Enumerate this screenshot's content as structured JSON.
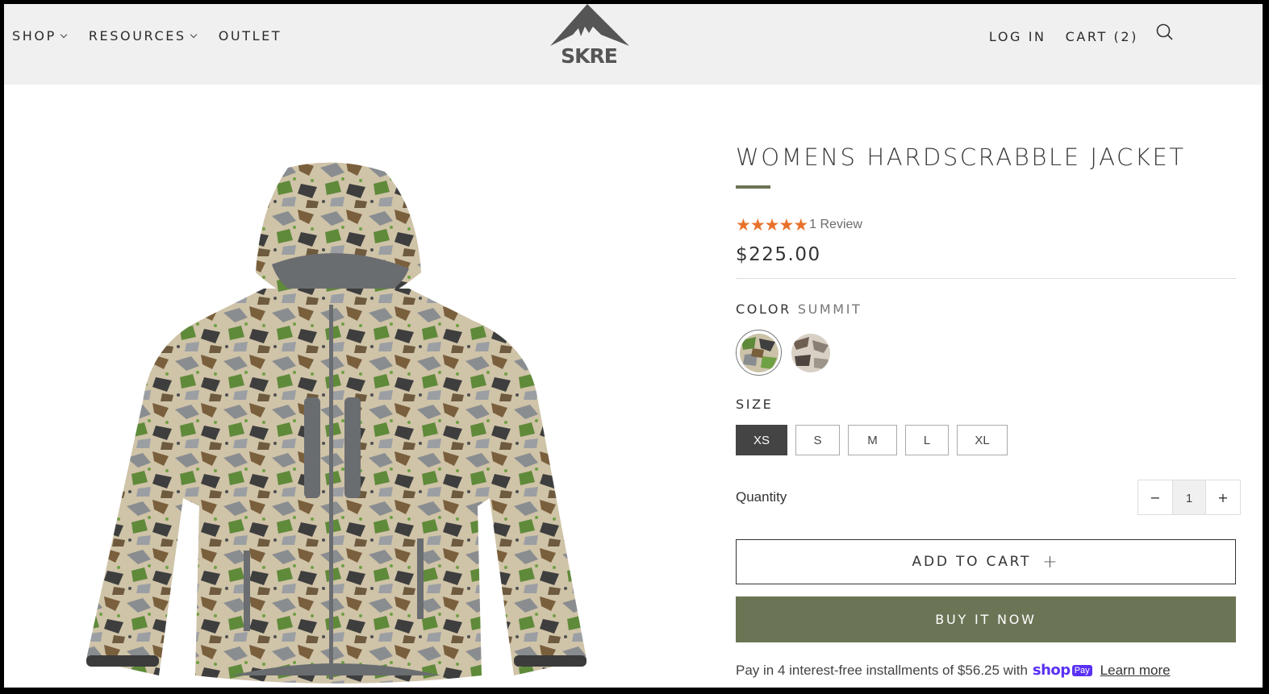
{
  "header": {
    "nav_left": [
      {
        "label": "SHOP",
        "has_dropdown": true
      },
      {
        "label": "RESOURCES",
        "has_dropdown": true
      },
      {
        "label": "OUTLET",
        "has_dropdown": false
      }
    ],
    "logo_text": "SKRE",
    "login_label": "LOG IN",
    "cart_label": "CART (2)",
    "search_icon": "search-icon"
  },
  "product": {
    "title": "WOMENS HARDSCRABBLE JACKET",
    "rating": {
      "stars": 5,
      "max": 5,
      "review_text": "1 Review"
    },
    "price": "$225.00",
    "color": {
      "label": "COLOR",
      "selected": "SUMMIT",
      "options": [
        {
          "name": "Summit",
          "selected": true
        },
        {
          "name": "Alternate camo",
          "selected": false
        }
      ]
    },
    "size": {
      "label": "SIZE",
      "options": [
        "XS",
        "S",
        "M",
        "L",
        "XL"
      ],
      "selected": "XS"
    },
    "quantity": {
      "label": "Quantity",
      "value": "1",
      "minus": "−",
      "plus": "+"
    },
    "add_to_cart_label": "ADD TO CART",
    "add_to_cart_icon": "+",
    "buy_now_label": "BUY IT NOW",
    "installments": {
      "text": "Pay in 4 interest-free installments of $56.25 with",
      "shop_word": "shop",
      "pay_badge": "Pay",
      "learn_more": "Learn more"
    }
  },
  "colors": {
    "accent": "#6b7556",
    "star": "#e8712a",
    "shop_pay": "#5a31f4",
    "header_bg": "#f0f0f0"
  }
}
